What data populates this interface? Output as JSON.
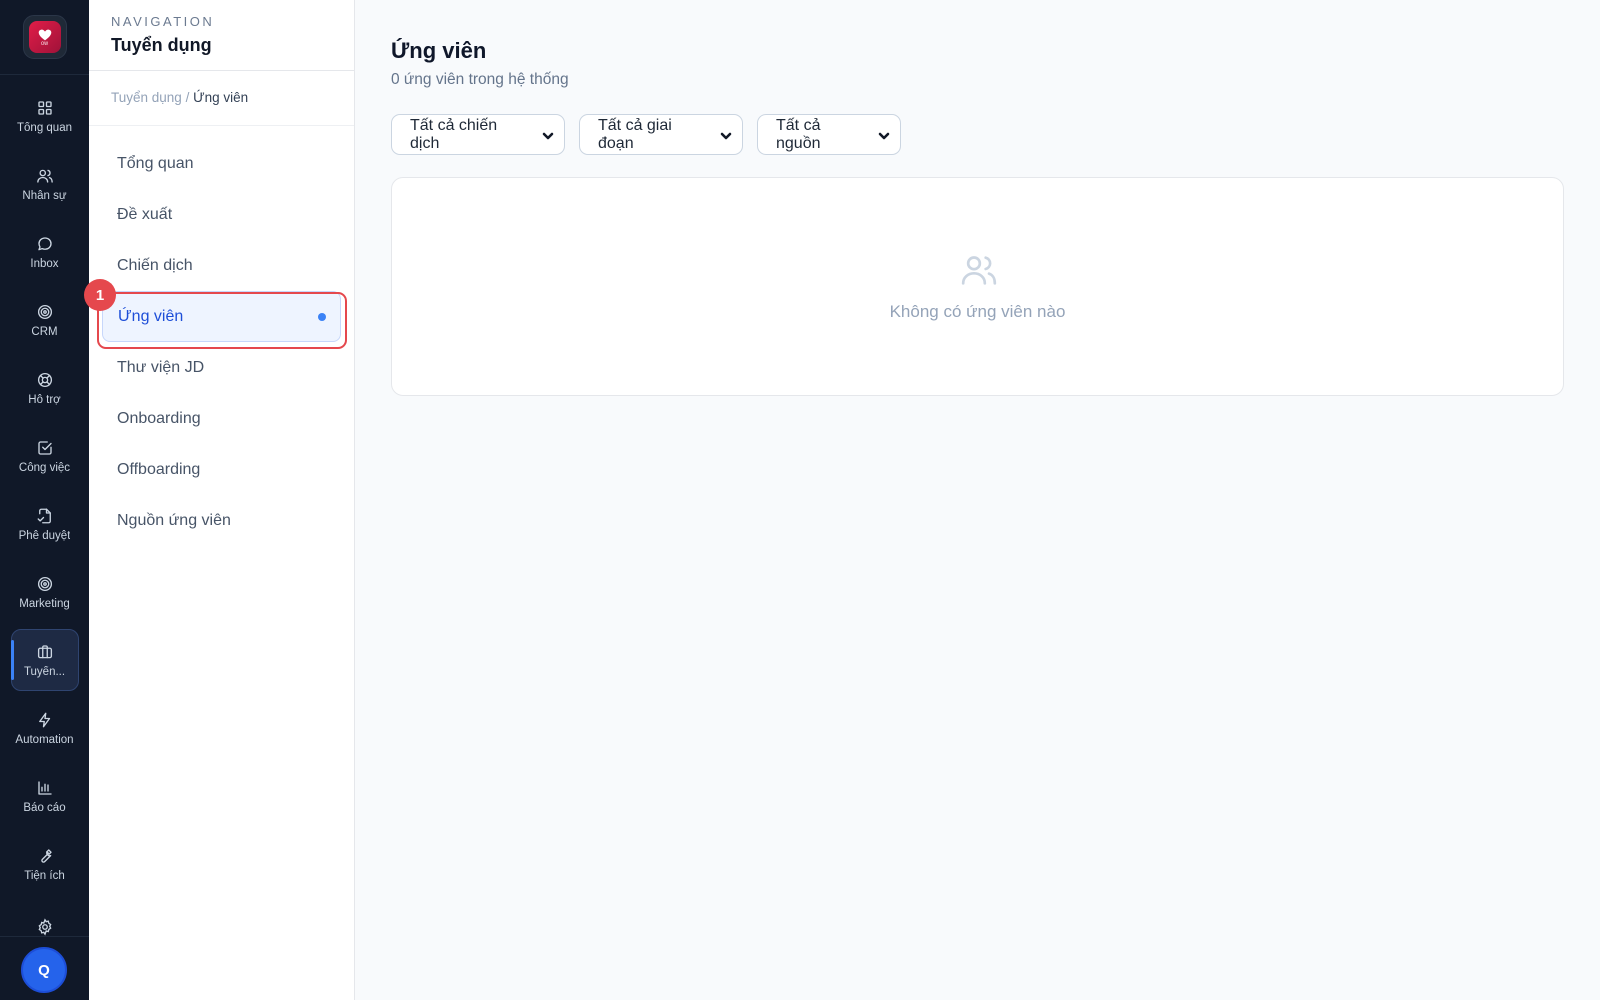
{
  "rail": {
    "logo": {
      "brand_text": "OW",
      "sub_text": "Work"
    },
    "items": [
      {
        "label": "Tổng quan",
        "icon": "grid-icon"
      },
      {
        "label": "Nhân sự",
        "icon": "users-icon"
      },
      {
        "label": "Inbox",
        "icon": "chat-bubble-icon"
      },
      {
        "label": "CRM",
        "icon": "target-icon"
      },
      {
        "label": "Hỗ trợ",
        "icon": "lifebuoy-icon"
      },
      {
        "label": "Công việc",
        "icon": "check-square-icon"
      },
      {
        "label": "Phê duyệt",
        "icon": "document-check-icon"
      },
      {
        "label": "Marketing",
        "icon": "target-icon"
      },
      {
        "label": "Tuyển...",
        "icon": "briefcase-icon",
        "active": true
      },
      {
        "label": "Automation",
        "icon": "lightning-icon"
      },
      {
        "label": "Báo cáo",
        "icon": "bar-chart-icon"
      },
      {
        "label": "Tiện ích",
        "icon": "wrench-icon"
      }
    ],
    "settings_icon": "gear-icon",
    "avatar_initial": "Q",
    "accent_color": "#3b82f6",
    "background_color": "#101828"
  },
  "nav": {
    "eyebrow": "NAVIGATION",
    "title": "Tuyển dụng",
    "breadcrumb": {
      "parent": "Tuyển dụng",
      "separator": "/",
      "current": "Ứng viên"
    },
    "items": [
      {
        "label": "Tổng quan"
      },
      {
        "label": "Đề xuất"
      },
      {
        "label": "Chiến dịch"
      },
      {
        "label": "Ứng viên",
        "active": true
      },
      {
        "label": "Thư viện JD"
      },
      {
        "label": "Onboarding"
      },
      {
        "label": "Offboarding"
      },
      {
        "label": "Nguồn ứng viên"
      }
    ],
    "step_badge": "1",
    "highlight_color": "#e5484d"
  },
  "main": {
    "title": "Ứng viên",
    "subtitle": "0 ứng viên trong hệ thống",
    "filters": [
      {
        "selected": "Tất cả chiến dịch"
      },
      {
        "selected": "Tất cả giai đoạn"
      },
      {
        "selected": "Tất cả nguồn"
      }
    ],
    "empty_state": {
      "icon": "users-icon",
      "text": "Không có ứng viên nào"
    }
  }
}
